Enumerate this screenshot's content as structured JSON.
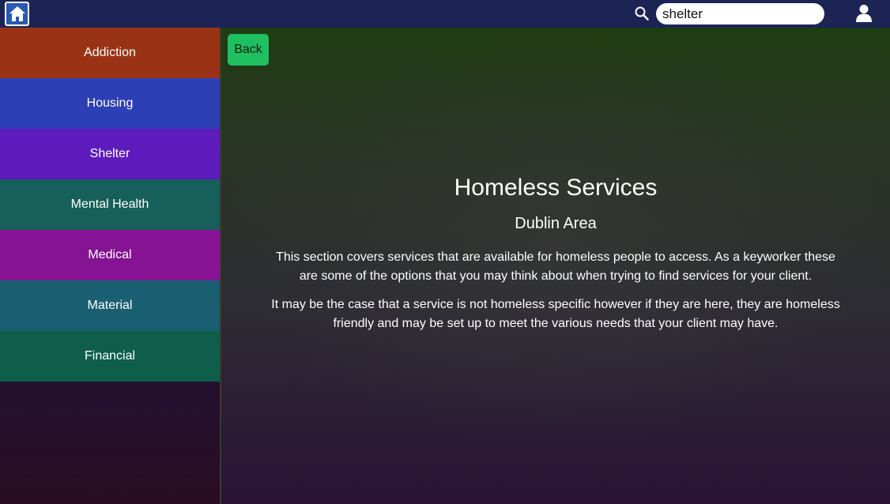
{
  "header": {
    "search": {
      "value": "shelter",
      "placeholder": ""
    },
    "icons": {
      "home": "home-icon",
      "search": "search-icon",
      "user": "user-icon"
    }
  },
  "sidebar": {
    "items": [
      {
        "label": "Addiction",
        "color": "#9a3316"
      },
      {
        "label": "Housing",
        "color": "#2d3fb5"
      },
      {
        "label": "Shelter",
        "color": "#5d1bbd"
      },
      {
        "label": "Mental Health",
        "color": "#175f5a"
      },
      {
        "label": "Medical",
        "color": "#861393"
      },
      {
        "label": "Material",
        "color": "#1a5e72"
      },
      {
        "label": "Financial",
        "color": "#0f5e4a"
      }
    ]
  },
  "main": {
    "back_label": "Back",
    "title": "Homeless Services",
    "subtitle": "Dublin Area",
    "paragraphs": [
      "This section covers services that are available for homeless people to access. As a keyworker these are some of the options that you may think about when trying to find services for your client.",
      "It may be the case that a service is not homeless specific however if they are here, they are homeless friendly and may be set up to meet the various needs that your client may have."
    ]
  },
  "colors": {
    "topbar": "#1b2455",
    "back_button": "#1fc062",
    "text": "#ffffff"
  }
}
